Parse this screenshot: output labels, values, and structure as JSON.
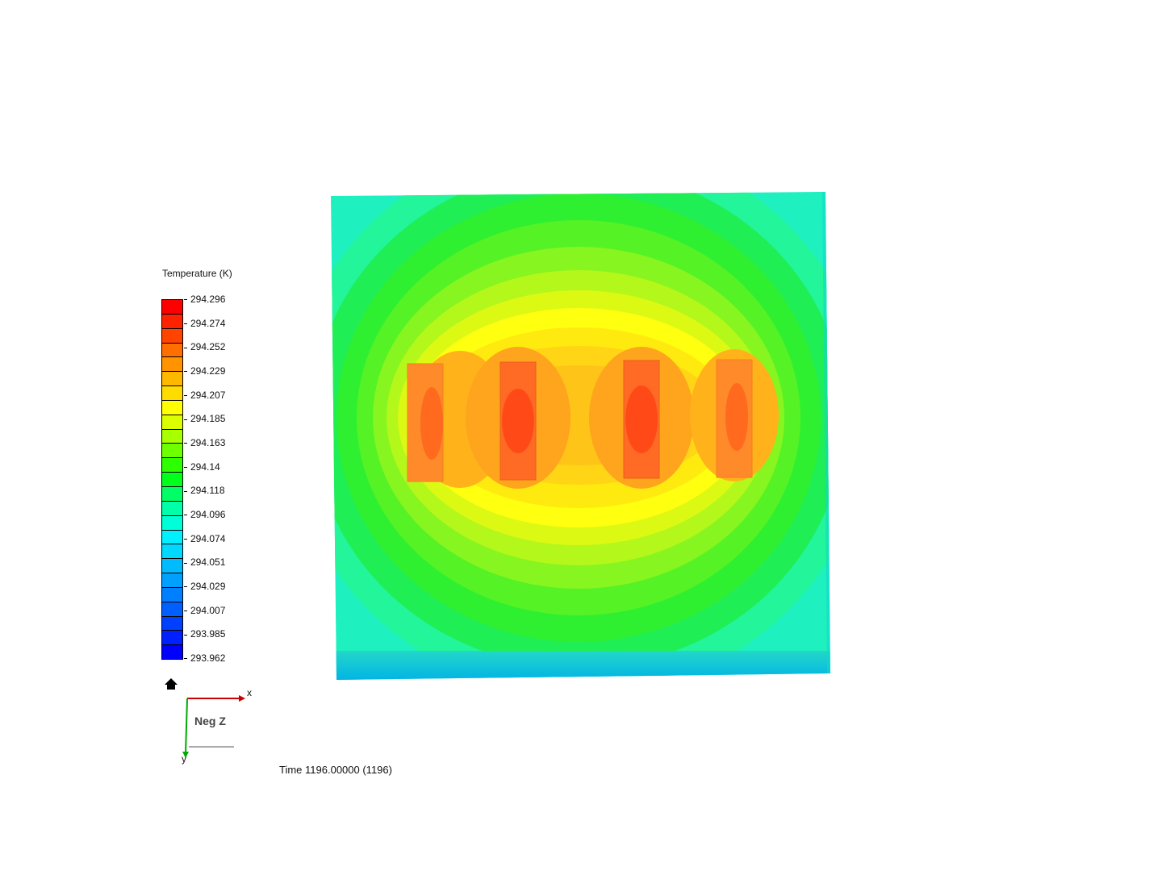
{
  "legend": {
    "title": "Temperature (K)",
    "labels": [
      "294.296",
      "294.274",
      "294.252",
      "294.229",
      "294.207",
      "294.185",
      "294.163",
      "294.14",
      "294.118",
      "294.096",
      "294.074",
      "294.051",
      "294.029",
      "294.007",
      "293.985",
      "293.962"
    ],
    "swatch_colors": [
      "#ff0000",
      "#ff2200",
      "#ff4400",
      "#ff6e00",
      "#ff9400",
      "#ffb800",
      "#ffdc00",
      "#ffff00",
      "#dcff00",
      "#a8ff00",
      "#6eff00",
      "#2eff00",
      "#00ff1a",
      "#00ff66",
      "#00ffa8",
      "#00ffd8",
      "#00f0ff",
      "#00d8ff",
      "#00bcff",
      "#00a0ff",
      "#0080ff",
      "#0060ff",
      "#0040ff",
      "#0020ff",
      "#0000ff"
    ]
  },
  "orientation": {
    "view_name": "Neg Z",
    "x_axis": "x",
    "y_axis": "y",
    "home_icon": "home-icon"
  },
  "status": {
    "time_text": "Time 1196.00000 (1196)"
  },
  "colors": {
    "axis_x": "#cc0000",
    "axis_y": "#00aa00",
    "background": "#ffffff"
  }
}
